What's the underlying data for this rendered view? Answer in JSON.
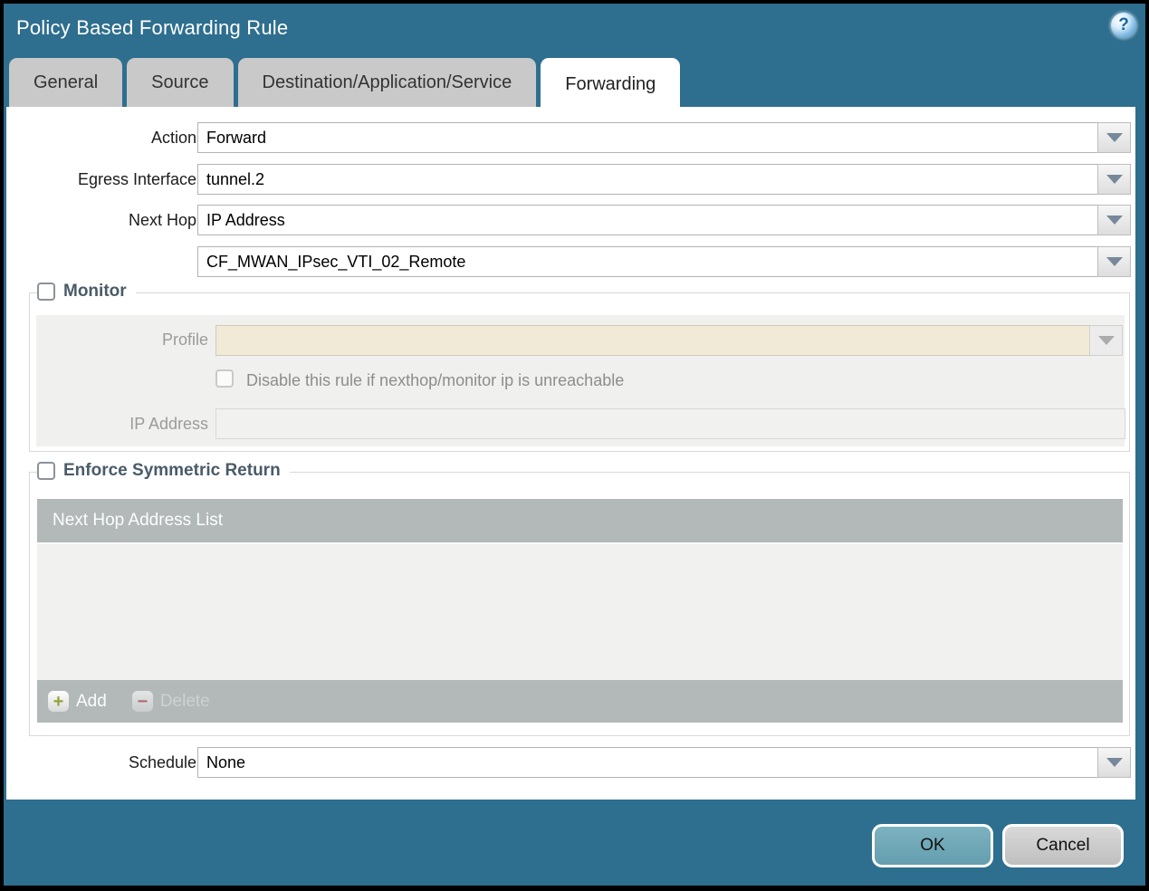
{
  "dialog": {
    "title": "Policy Based Forwarding Rule",
    "help_glyph": "?"
  },
  "tabs": [
    {
      "label": "General",
      "active": false
    },
    {
      "label": "Source",
      "active": false
    },
    {
      "label": "Destination/Application/Service",
      "active": false
    },
    {
      "label": "Forwarding",
      "active": true
    }
  ],
  "form": {
    "action": {
      "label": "Action",
      "value": "Forward"
    },
    "egress_interface": {
      "label": "Egress Interface",
      "value": "tunnel.2"
    },
    "next_hop": {
      "label": "Next Hop",
      "value": "IP Address"
    },
    "next_hop_address": {
      "value": "CF_MWAN_IPsec_VTI_02_Remote"
    },
    "schedule": {
      "label": "Schedule",
      "value": "None"
    }
  },
  "monitor": {
    "legend": "Monitor",
    "checked": false,
    "profile": {
      "label": "Profile",
      "value": ""
    },
    "disable_rule_checkbox": {
      "label": "Disable this rule if nexthop/monitor ip is unreachable",
      "checked": false
    },
    "ip_address": {
      "label": "IP Address",
      "value": ""
    }
  },
  "symmetric_return": {
    "legend": "Enforce Symmetric Return",
    "checked": false,
    "table": {
      "header": "Next Hop Address List",
      "rows": [],
      "add_label": "Add",
      "delete_label": "Delete",
      "add_glyph": "+",
      "delete_glyph": "−"
    }
  },
  "footer": {
    "ok_label": "OK",
    "cancel_label": "Cancel"
  },
  "colors": {
    "frame_teal": "#2e6e8e",
    "tab_inactive": "#c9c9c9",
    "table_gray": "#b3b8b8",
    "disabled_beige": "#f0ead6",
    "ok_button": "#6ea8b8",
    "legend_text": "#4a5b68"
  }
}
